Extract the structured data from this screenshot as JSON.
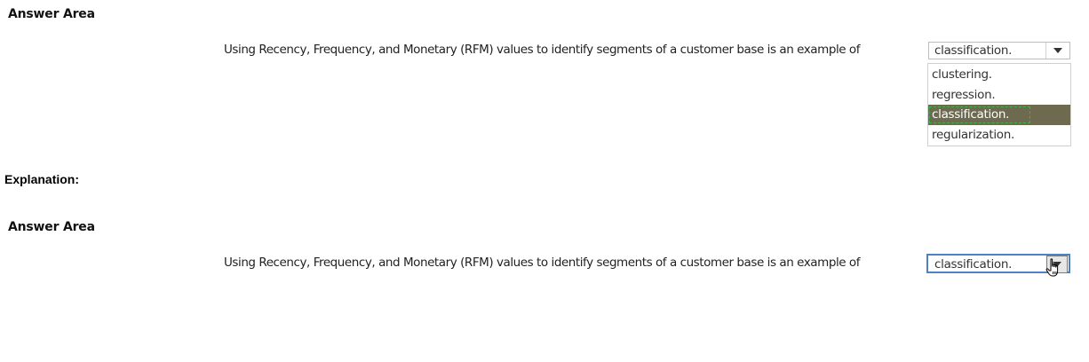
{
  "answer_area_1": {
    "heading": "Answer Area",
    "question": "Using Recency, Frequency, and Monetary (RFM) values to identify segments of a customer base is an example of",
    "dropdown": {
      "selected_value": "classification.",
      "arrow_icon": "caret-down-icon",
      "state": "expanded",
      "options": [
        "clustering.",
        "regression.",
        "classification.",
        "regularization."
      ],
      "highlighted_option": "classification."
    }
  },
  "explanation_label": "Explanation:",
  "answer_area_2": {
    "heading": "Answer Area",
    "question": "Using Recency, Frequency, and Monetary (RFM) values to identify segments of a customer base is an example of",
    "dropdown": {
      "selected_value": "classification.",
      "arrow_icon": "caret-down-icon",
      "state": "focused",
      "cursor_icon": "hand-pointer-icon"
    }
  },
  "colors": {
    "highlight_bg": "#6e6a50",
    "focus_ring": "#4f81c7",
    "dashed_focus": "#3fb24a"
  }
}
